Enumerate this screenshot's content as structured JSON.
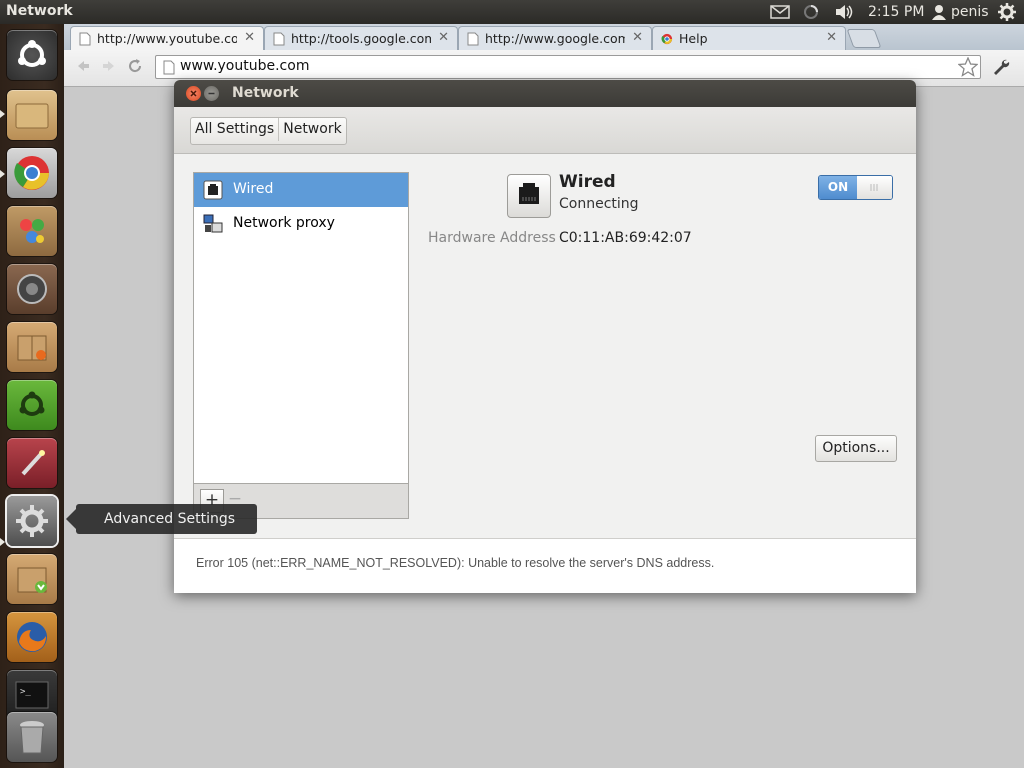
{
  "top_panel": {
    "app_title": "Network",
    "time": "2:15 PM",
    "user": "penis",
    "icons": [
      "mail-icon",
      "network-spinner-icon",
      "volume-icon",
      "user-icon",
      "gear-icon"
    ]
  },
  "launcher": {
    "items": [
      {
        "name": "dash-home",
        "icon": "ubuntu-logo-icon",
        "color": "#6a6a6a"
      },
      {
        "name": "files",
        "icon": "folder-icon",
        "color": "#c9a66b",
        "running": true
      },
      {
        "name": "chromium",
        "icon": "chrome-icon",
        "color": "#b8b8b8",
        "running": true
      },
      {
        "name": "gimp",
        "icon": "paint-icon",
        "color": "#a07f52"
      },
      {
        "name": "rhythmbox",
        "icon": "speaker-icon",
        "color": "#6e4f3b"
      },
      {
        "name": "software-center",
        "icon": "package-icon",
        "color": "#b9895a"
      },
      {
        "name": "ubuntu-one",
        "icon": "ubuntu-one-icon",
        "color": "#4f9a2c"
      },
      {
        "name": "tweak",
        "icon": "magic-wand-icon",
        "color": "#8e2c34"
      },
      {
        "name": "advanced-settings",
        "icon": "gear-icon",
        "color": "#7a7a7a",
        "running": true
      },
      {
        "name": "update-manager",
        "icon": "download-package-icon",
        "color": "#b9895a"
      },
      {
        "name": "firefox",
        "icon": "firefox-icon",
        "color": "#b97a2c"
      },
      {
        "name": "terminal",
        "icon": "terminal-icon",
        "color": "#2b2b2b"
      },
      {
        "name": "trash",
        "icon": "trash-icon",
        "color": "#777777"
      }
    ],
    "tooltip": "Advanced Settings"
  },
  "browser": {
    "tabs": [
      {
        "label": "http://www.youtube.com/",
        "active": true
      },
      {
        "label": "http://tools.google.com/c",
        "active": false
      },
      {
        "label": "http://www.google.com/s",
        "active": false
      },
      {
        "label": "Help",
        "active": false
      }
    ],
    "url": "www.youtube.com",
    "error": "Error 105 (net::ERR_NAME_NOT_RESOLVED): Unable to resolve the server's DNS address."
  },
  "network_window": {
    "title": "Network",
    "breadcrumbs": [
      "All Settings",
      "Network"
    ],
    "connections": [
      {
        "label": "Wired",
        "icon": "ethernet-icon",
        "selected": true
      },
      {
        "label": "Network proxy",
        "icon": "network-proxy-icon",
        "selected": false
      }
    ],
    "list_add": "+",
    "list_remove": "−",
    "device": {
      "title": "Wired",
      "status": "Connecting",
      "hw_label": "Hardware Address",
      "hw_value": "C0:11:AB:69:42:07",
      "toggle": "ON"
    },
    "options_button": "Options..."
  },
  "colors": {
    "selection": "#5e9bd8",
    "launcher_bg": "#33261c",
    "panel_bg": "#3c3b37"
  }
}
